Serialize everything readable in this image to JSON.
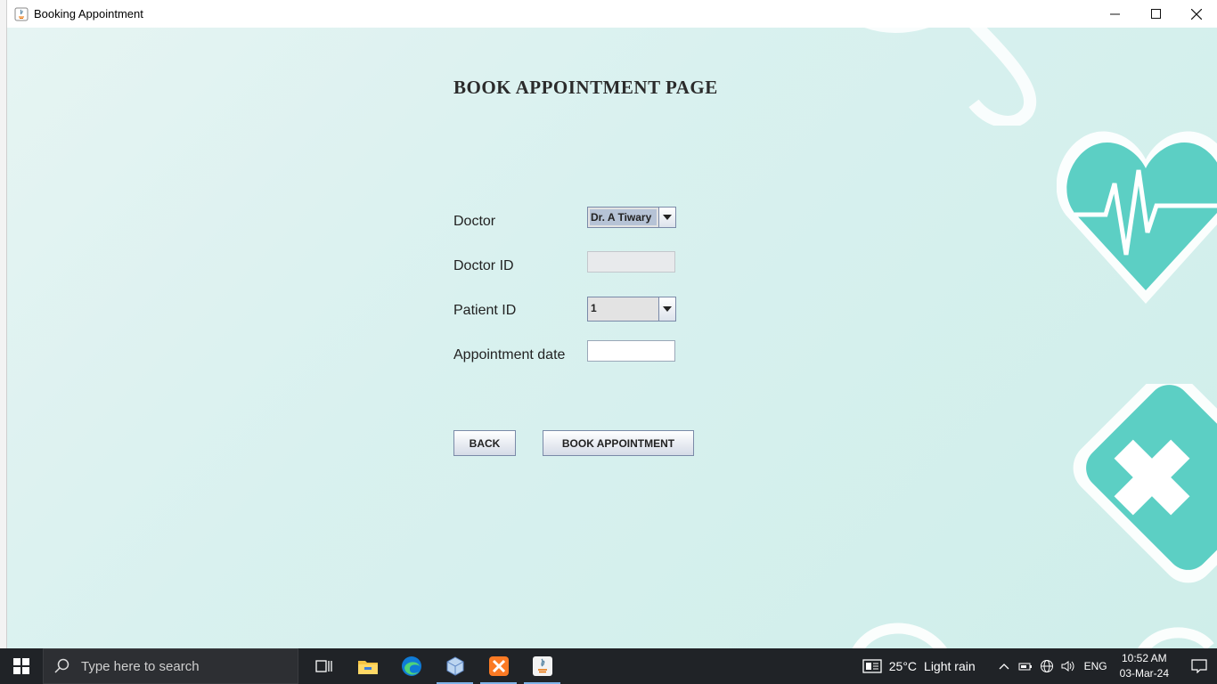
{
  "window": {
    "title": "Booking Appointment",
    "controls": {
      "minimize": "—",
      "maximize": "☐",
      "close": "✕"
    }
  },
  "page": {
    "heading": "BOOK APPOINTMENT PAGE"
  },
  "form": {
    "doctor": {
      "label": "Doctor",
      "value": "Dr. A Tiwary"
    },
    "doctor_id": {
      "label": "Doctor ID",
      "value": ""
    },
    "patient_id": {
      "label": "Patient ID",
      "value": "1"
    },
    "appointment_date": {
      "label": "Appointment date",
      "value": ""
    }
  },
  "buttons": {
    "back": "BACK",
    "book": "BOOK APPOINTMENT"
  },
  "colors": {
    "background": "#d9f1ef",
    "accent_teal": "#5ccfc4"
  },
  "taskbar": {
    "search_placeholder": "Type here to search",
    "apps": [
      "task-view-icon",
      "file-explorer-icon",
      "edge-icon",
      "virtualbox-icon",
      "xampp-icon",
      "java-icon"
    ],
    "weather": {
      "temp": "25°C",
      "condition": "Light rain"
    },
    "language": "ENG",
    "time": "10:52 AM",
    "date": "03-Mar-24"
  }
}
